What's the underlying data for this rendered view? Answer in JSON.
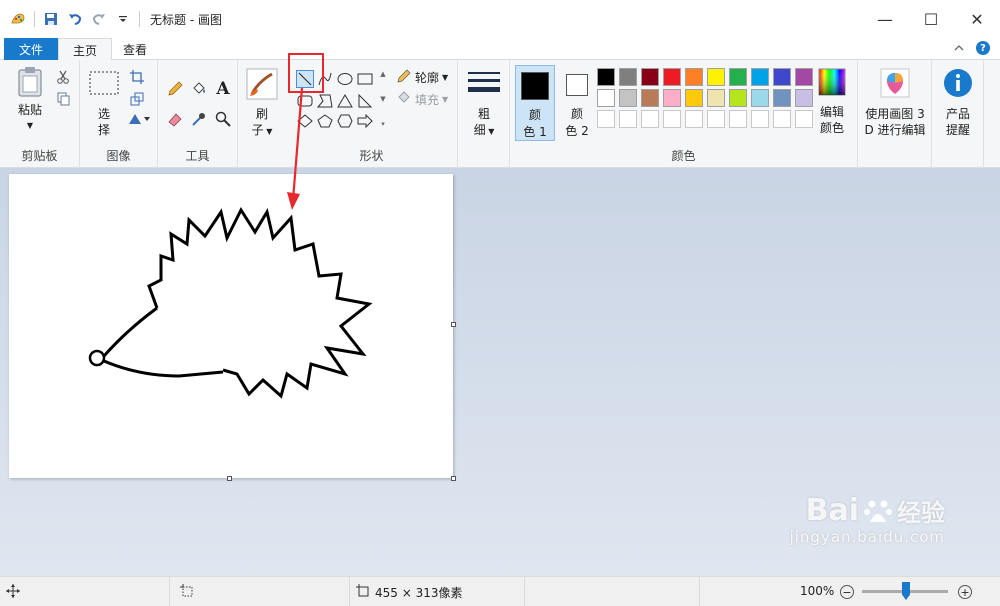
{
  "window": {
    "title": "无标题 - 画图",
    "minimize": "—",
    "maximize": "☐",
    "close": "✕"
  },
  "tabs": {
    "file": "文件",
    "home": "主页",
    "view": "查看"
  },
  "ribbon": {
    "clipboard": {
      "paste": "粘贴",
      "label": "剪贴板"
    },
    "image": {
      "select_1": "选",
      "select_2": "择",
      "label": "图像"
    },
    "tools": {
      "label": "工具"
    },
    "brush": {
      "line1": "刷",
      "line2": "子"
    },
    "shapes": {
      "outline": "轮廓",
      "fill": "填充",
      "label": "形状"
    },
    "size": {
      "line1": "粗",
      "line2": "细"
    },
    "color1": {
      "line1": "颜",
      "line2": "色 1"
    },
    "color2": {
      "line1": "颜",
      "line2": "色 2"
    },
    "edit_colors": {
      "line1": "编辑",
      "line2": "颜色"
    },
    "colors_label": "颜色",
    "paint3d": {
      "line1": "使用画图 3",
      "line2": "D 进行编辑"
    },
    "product_alert": {
      "line1": "产品",
      "line2": "提醒"
    }
  },
  "palette_row1": [
    "#000000",
    "#7f7f7f",
    "#880015",
    "#ed1c24",
    "#ff7f27",
    "#fff200",
    "#22b14c",
    "#00a2e8",
    "#3f48cc",
    "#a349a4"
  ],
  "palette_row2": [
    "#ffffff",
    "#c3c3c3",
    "#b97a57",
    "#ffaec9",
    "#ffc90e",
    "#efe4b0",
    "#b5e61d",
    "#99d9ea",
    "#7092be",
    "#c8bfe7"
  ],
  "status": {
    "canvas_size": "455 × 313像素",
    "zoom": "100%"
  },
  "watermark": {
    "brand": "Bai",
    "brand_suffix": "经验",
    "url": "jingyan.baidu.com"
  },
  "colors": {
    "accent": "#1979ca",
    "highlight": "#e8282d"
  }
}
